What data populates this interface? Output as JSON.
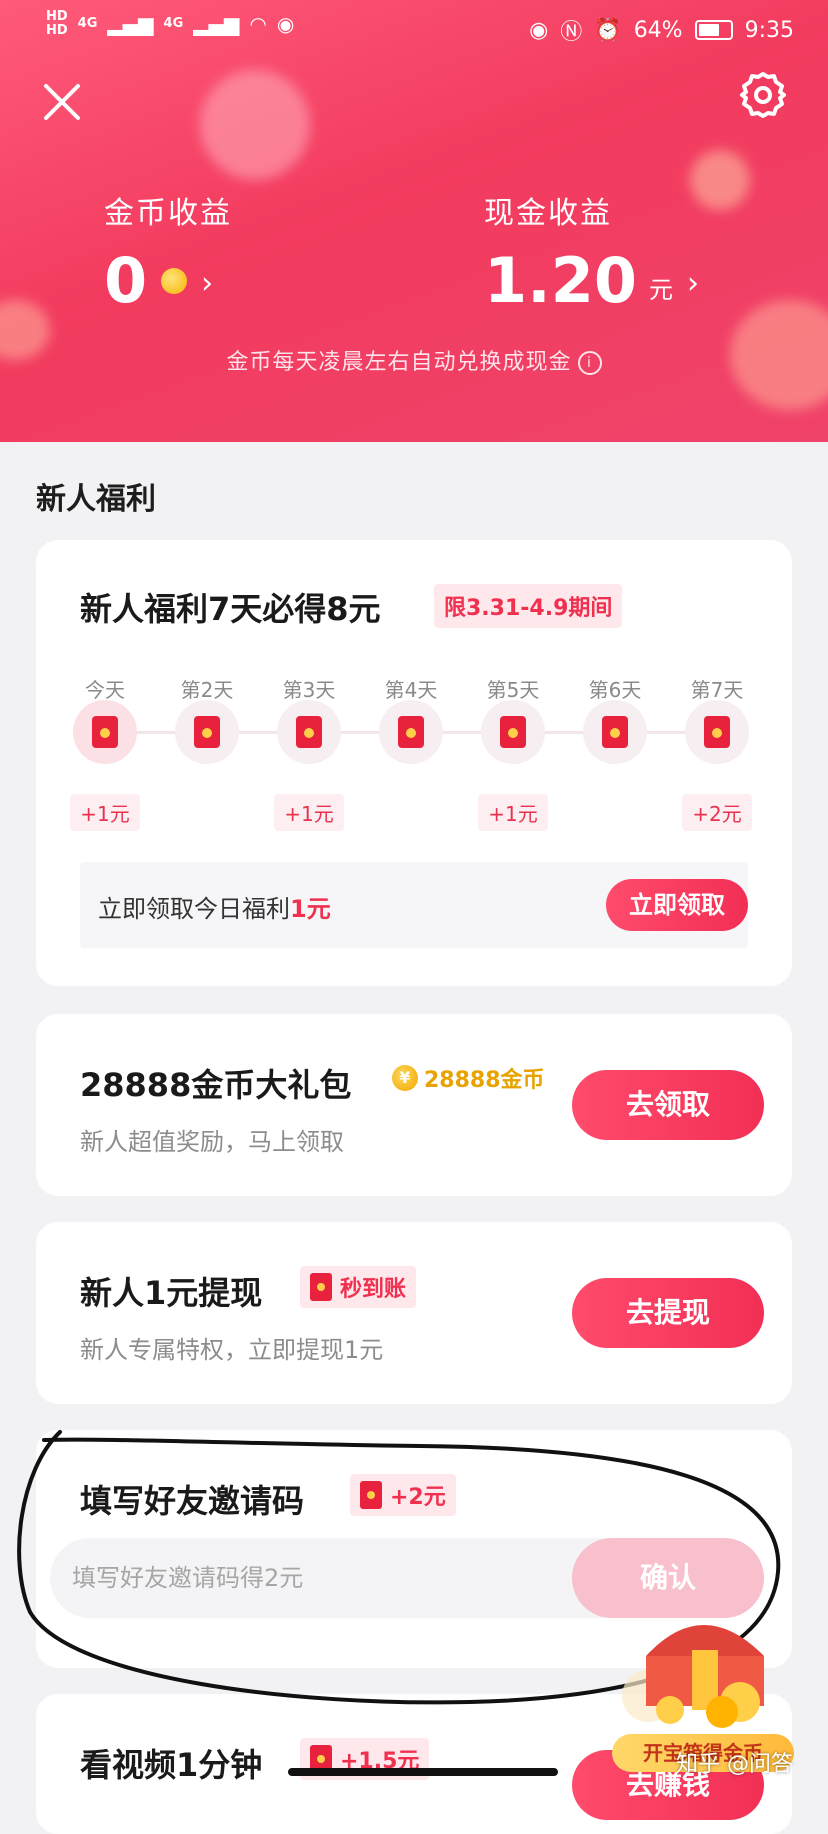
{
  "status_bar": {
    "left_tags": [
      "HD",
      "HD"
    ],
    "signal_labels": [
      "4G",
      "4G"
    ],
    "battery": "64%",
    "time": "9:35"
  },
  "header": {
    "coin_label": "金币收益",
    "coin_value": "0",
    "cash_label": "现金收益",
    "cash_value": "1.20",
    "cash_unit": "元",
    "chevron": "›",
    "note": "金币每天凌晨左右自动兑换成现金",
    "info_glyph": "i"
  },
  "section_title": "新人福利",
  "welfare_card": {
    "title": "新人福利7天必得8元",
    "badge": "限3.31-4.9期间",
    "days": [
      {
        "label": "今天",
        "reward": "+1元"
      },
      {
        "label": "第2天",
        "reward": ""
      },
      {
        "label": "第3天",
        "reward": "+1元"
      },
      {
        "label": "第4天",
        "reward": ""
      },
      {
        "label": "第5天",
        "reward": "+1元"
      },
      {
        "label": "第6天",
        "reward": ""
      },
      {
        "label": "第7天",
        "reward": "+2元"
      }
    ],
    "claim_text": "立即领取今日福利",
    "claim_amount": "1元",
    "claim_button": "立即领取"
  },
  "gift_card": {
    "title": "28888金币大礼包",
    "coin_badge": "28888金币",
    "coin_glyph": "¥",
    "subtitle": "新人超值奖励，马上领取",
    "button": "去领取"
  },
  "withdraw_card": {
    "title": "新人1元提现",
    "badge": "秒到账",
    "subtitle": "新人专属特权，立即提现1元",
    "button": "去提现"
  },
  "invite_card": {
    "title": "填写好友邀请码",
    "badge": "+2元",
    "input_placeholder": "填写好友邀请码得2元",
    "confirm_button": "确认"
  },
  "video_card": {
    "title": "看视频1分钟",
    "badge": "+1.5元",
    "button": "去赚钱"
  },
  "treasure_box": {
    "label": "开宝箱得金币"
  },
  "watermark": "知乎 @问答",
  "colors": {
    "brand": "#f23b5e",
    "accent_gold": "#f7b500",
    "annotation": "#111111"
  }
}
